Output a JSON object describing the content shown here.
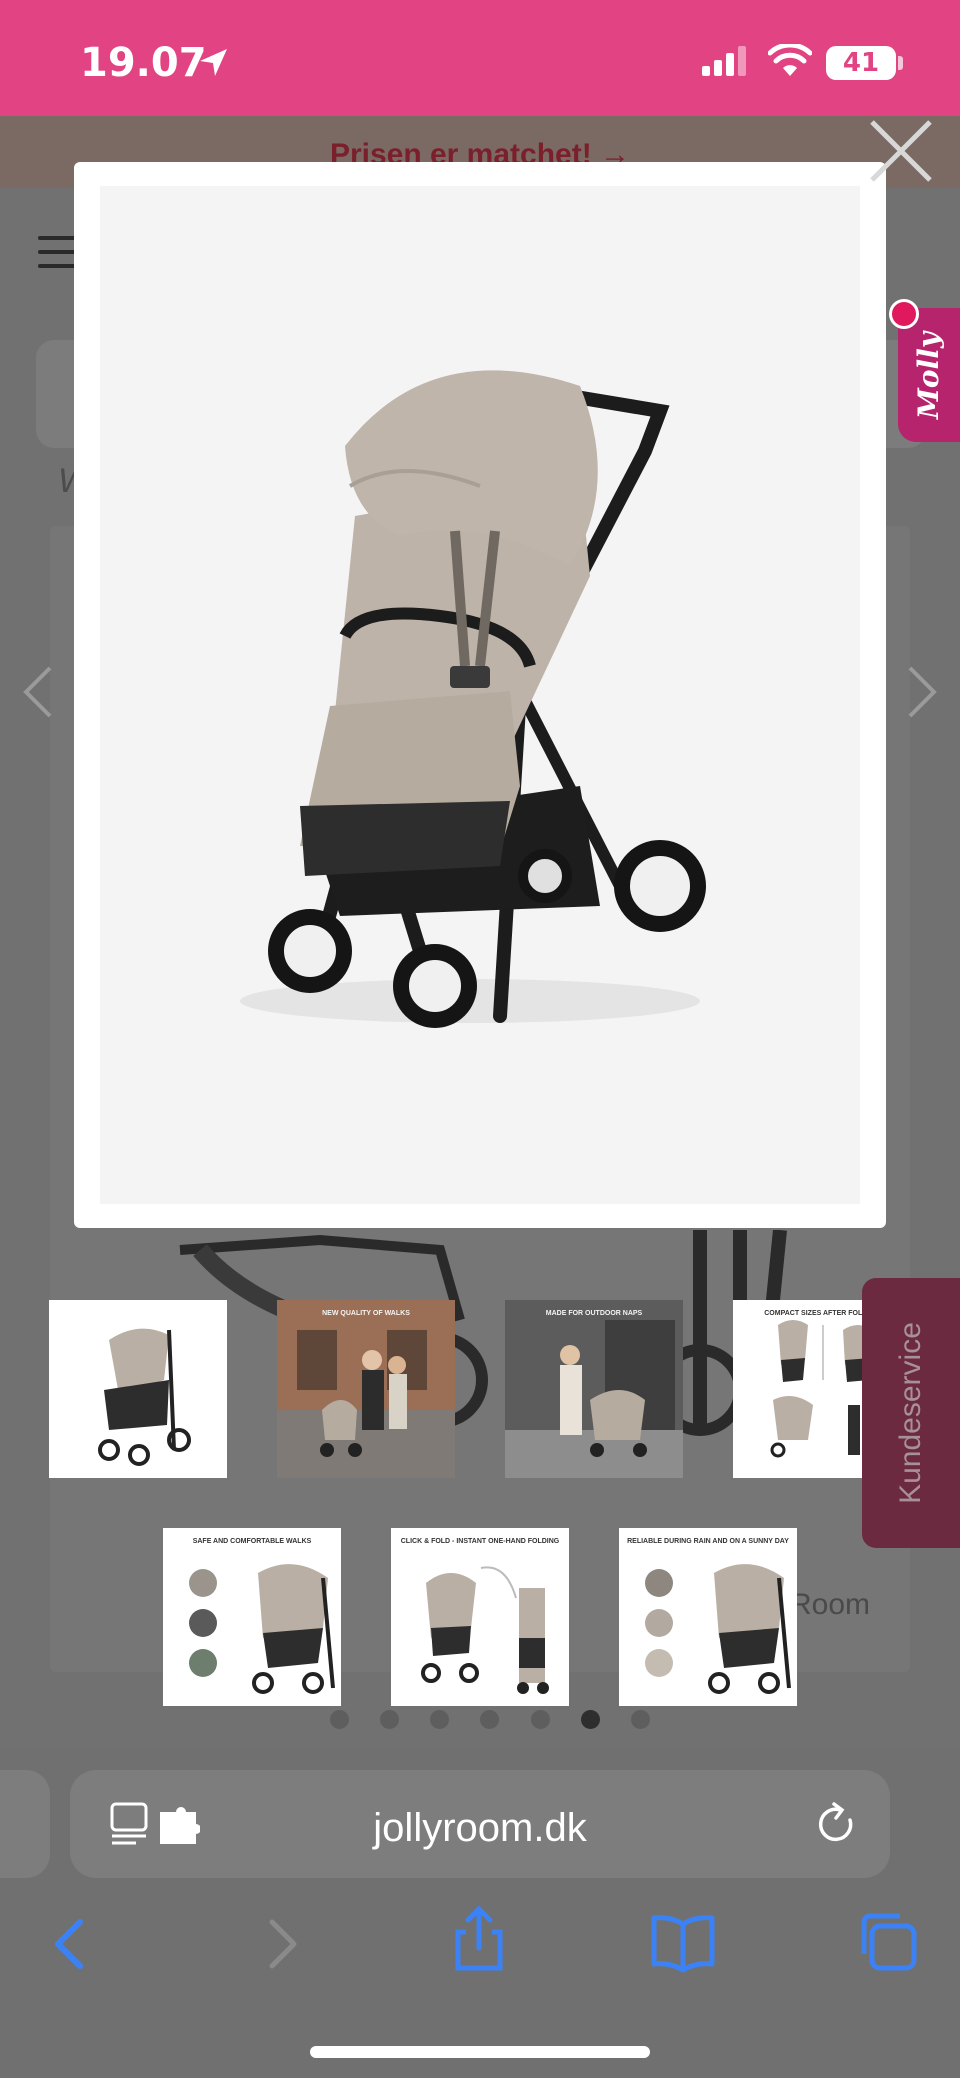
{
  "status_bar": {
    "time": "19.07",
    "battery": "41"
  },
  "page": {
    "banner": "Prisen er matchet! →",
    "partial_text": "W",
    "partial_room": "Room"
  },
  "molly": {
    "label": "Molly"
  },
  "kundeservice": {
    "label": "Kundeservice"
  },
  "thumbnails": [
    {
      "caption": ""
    },
    {
      "caption": "NEW QUALITY OF WALKS"
    },
    {
      "caption": "MADE FOR OUTDOOR NAPS"
    },
    {
      "caption": "COMPACT SIZES AFTER FOLDING"
    },
    {
      "caption": "SAFE AND COMFORTABLE WALKS"
    },
    {
      "caption": "CLICK & FOLD - INSTANT ONE-HAND FOLDING"
    },
    {
      "caption": "RELIABLE DURING RAIN AND ON A SUNNY DAY"
    }
  ],
  "carousel": {
    "dot_count": 7,
    "active_index": 5
  },
  "browser": {
    "url": "jollyroom.dk"
  },
  "colors": {
    "brand_pink": "#e24483",
    "overlay_gray": "#6b6b6b",
    "safari_blue": "#3b82f6"
  },
  "icons": [
    "location-arrow-icon",
    "signal-icon",
    "wifi-icon",
    "battery-icon",
    "close-icon",
    "chevron-left-icon",
    "chevron-right-icon",
    "reader-mode-icon",
    "extension-icon",
    "reload-icon",
    "back-icon",
    "forward-icon",
    "share-icon",
    "bookmarks-icon",
    "tabs-icon"
  ]
}
